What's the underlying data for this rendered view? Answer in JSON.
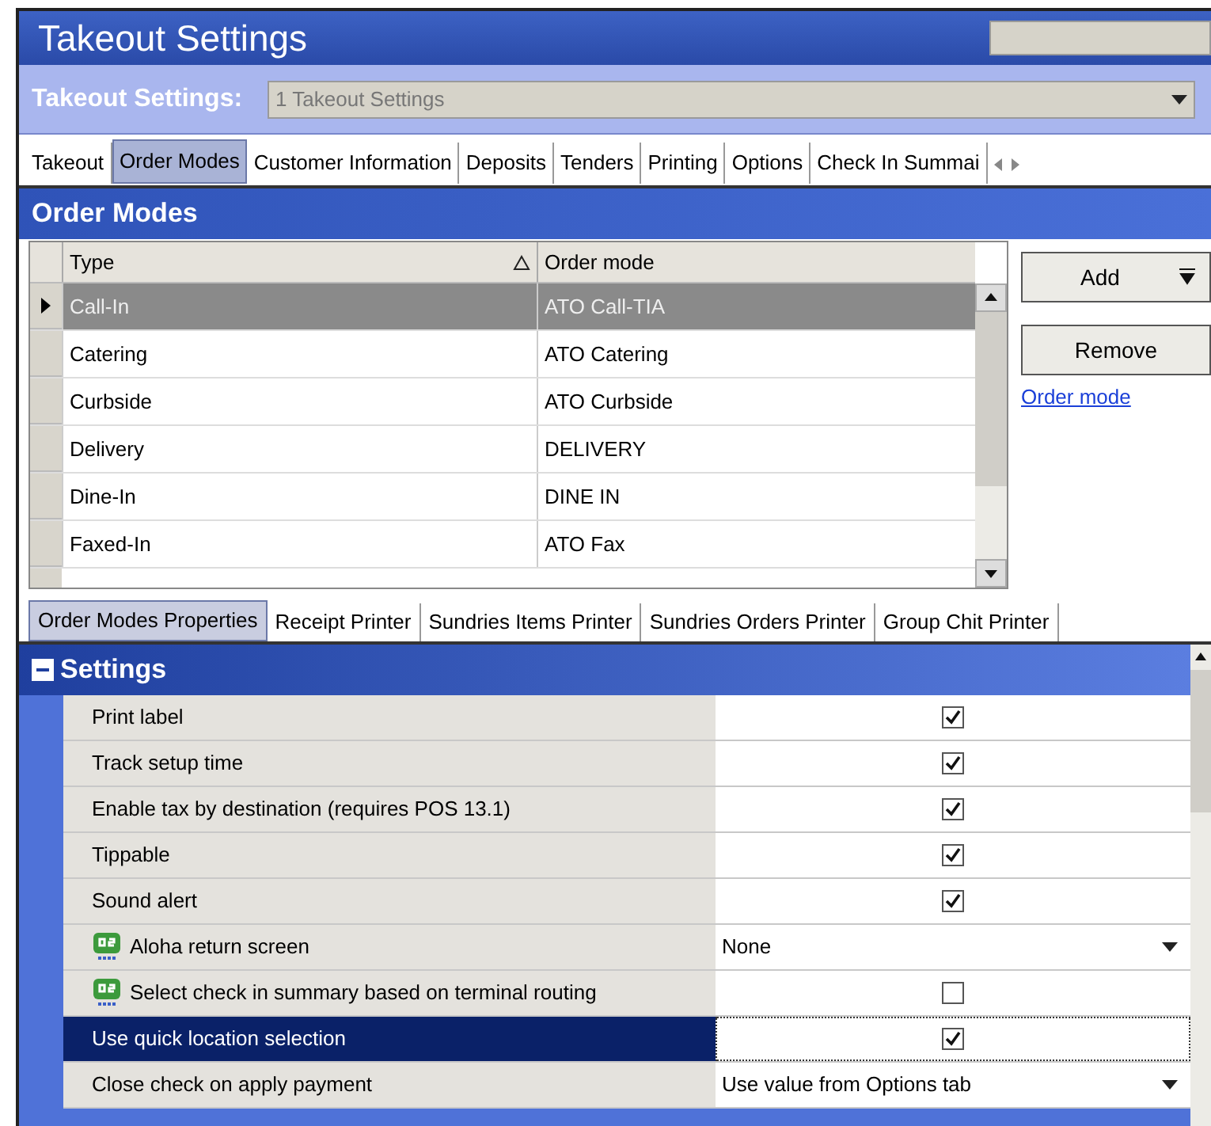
{
  "window": {
    "title": "Takeout Settings"
  },
  "selector": {
    "label": "Takeout Settings:",
    "value": "1 Takeout Settings"
  },
  "tabs": [
    {
      "label": "Takeout",
      "selected": false
    },
    {
      "label": "Order Modes",
      "selected": true
    },
    {
      "label": "Customer Information",
      "selected": false
    },
    {
      "label": "Deposits",
      "selected": false
    },
    {
      "label": "Tenders",
      "selected": false
    },
    {
      "label": "Printing",
      "selected": false
    },
    {
      "label": "Options",
      "selected": false
    },
    {
      "label": "Check In Summai",
      "selected": false
    }
  ],
  "section": {
    "title": "Order Modes"
  },
  "table": {
    "columns": [
      "Type",
      "Order mode"
    ],
    "rows": [
      {
        "type": "Call-In",
        "order_mode": "ATO Call-TIA",
        "selected": true
      },
      {
        "type": "Catering",
        "order_mode": "ATO Catering",
        "selected": false
      },
      {
        "type": "Curbside",
        "order_mode": "ATO Curbside",
        "selected": false
      },
      {
        "type": "Delivery",
        "order_mode": "DELIVERY",
        "selected": false
      },
      {
        "type": "Dine-In",
        "order_mode": "DINE IN",
        "selected": false
      },
      {
        "type": "Faxed-In",
        "order_mode": "ATO Fax",
        "selected": false
      }
    ]
  },
  "actions": {
    "add": "Add",
    "remove": "Remove",
    "link": "Order mode"
  },
  "sub_tabs": [
    {
      "label": "Order Modes Properties",
      "selected": true
    },
    {
      "label": "Receipt Printer",
      "selected": false
    },
    {
      "label": "Sundries Items Printer",
      "selected": false
    },
    {
      "label": "Sundries Orders Printer",
      "selected": false
    },
    {
      "label": "Group Chit Printer",
      "selected": false
    }
  ],
  "properties": {
    "title": "Settings",
    "expanded": true,
    "rows": [
      {
        "label": "Print label",
        "kind": "checkbox",
        "checked": true,
        "quick_service": false,
        "selected": false
      },
      {
        "label": "Track setup time",
        "kind": "checkbox",
        "checked": true,
        "quick_service": false,
        "selected": false
      },
      {
        "label": "Enable tax by destination (requires POS 13.1)",
        "kind": "checkbox",
        "checked": true,
        "quick_service": false,
        "selected": false
      },
      {
        "label": "Tippable",
        "kind": "checkbox",
        "checked": true,
        "quick_service": false,
        "selected": false
      },
      {
        "label": "Sound alert",
        "kind": "checkbox",
        "checked": true,
        "quick_service": false,
        "selected": false
      },
      {
        "label": "Aloha return screen",
        "kind": "dropdown",
        "value": "None",
        "quick_service": true,
        "selected": false
      },
      {
        "label": "Select check in summary based on terminal routing",
        "kind": "checkbox",
        "checked": false,
        "quick_service": true,
        "selected": false
      },
      {
        "label": "Use quick location selection",
        "kind": "checkbox",
        "checked": true,
        "quick_service": false,
        "selected": true
      },
      {
        "label": "Close check on apply payment",
        "kind": "dropdown",
        "value": "Use value from Options tab",
        "quick_service": false,
        "selected": false
      }
    ]
  }
}
